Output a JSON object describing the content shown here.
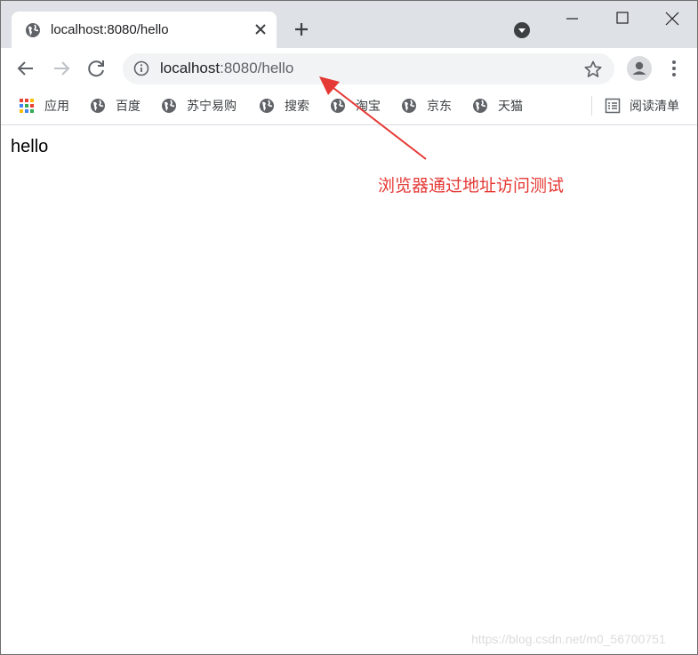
{
  "tab": {
    "title": "localhost:8080/hello"
  },
  "omnibox": {
    "host": "localhost",
    "path": ":8080/hello"
  },
  "bookmarks": [
    {
      "label": "应用",
      "icon": "apps-grid-icon"
    },
    {
      "label": "百度",
      "icon": "globe-icon"
    },
    {
      "label": "苏宁易购",
      "icon": "globe-icon"
    },
    {
      "label": "搜索",
      "icon": "globe-icon"
    },
    {
      "label": "淘宝",
      "icon": "globe-icon"
    },
    {
      "label": "京东",
      "icon": "globe-icon"
    },
    {
      "label": "天猫",
      "icon": "globe-icon"
    }
  ],
  "reading_list": {
    "label": "阅读清单",
    "icon": "reading-list-icon"
  },
  "page": {
    "text": "hello"
  },
  "annotation": {
    "text": "浏览器通过地址访问测试",
    "color": "#e53935"
  },
  "watermark": {
    "text": "https://blog.csdn.net/m0_56700751"
  }
}
